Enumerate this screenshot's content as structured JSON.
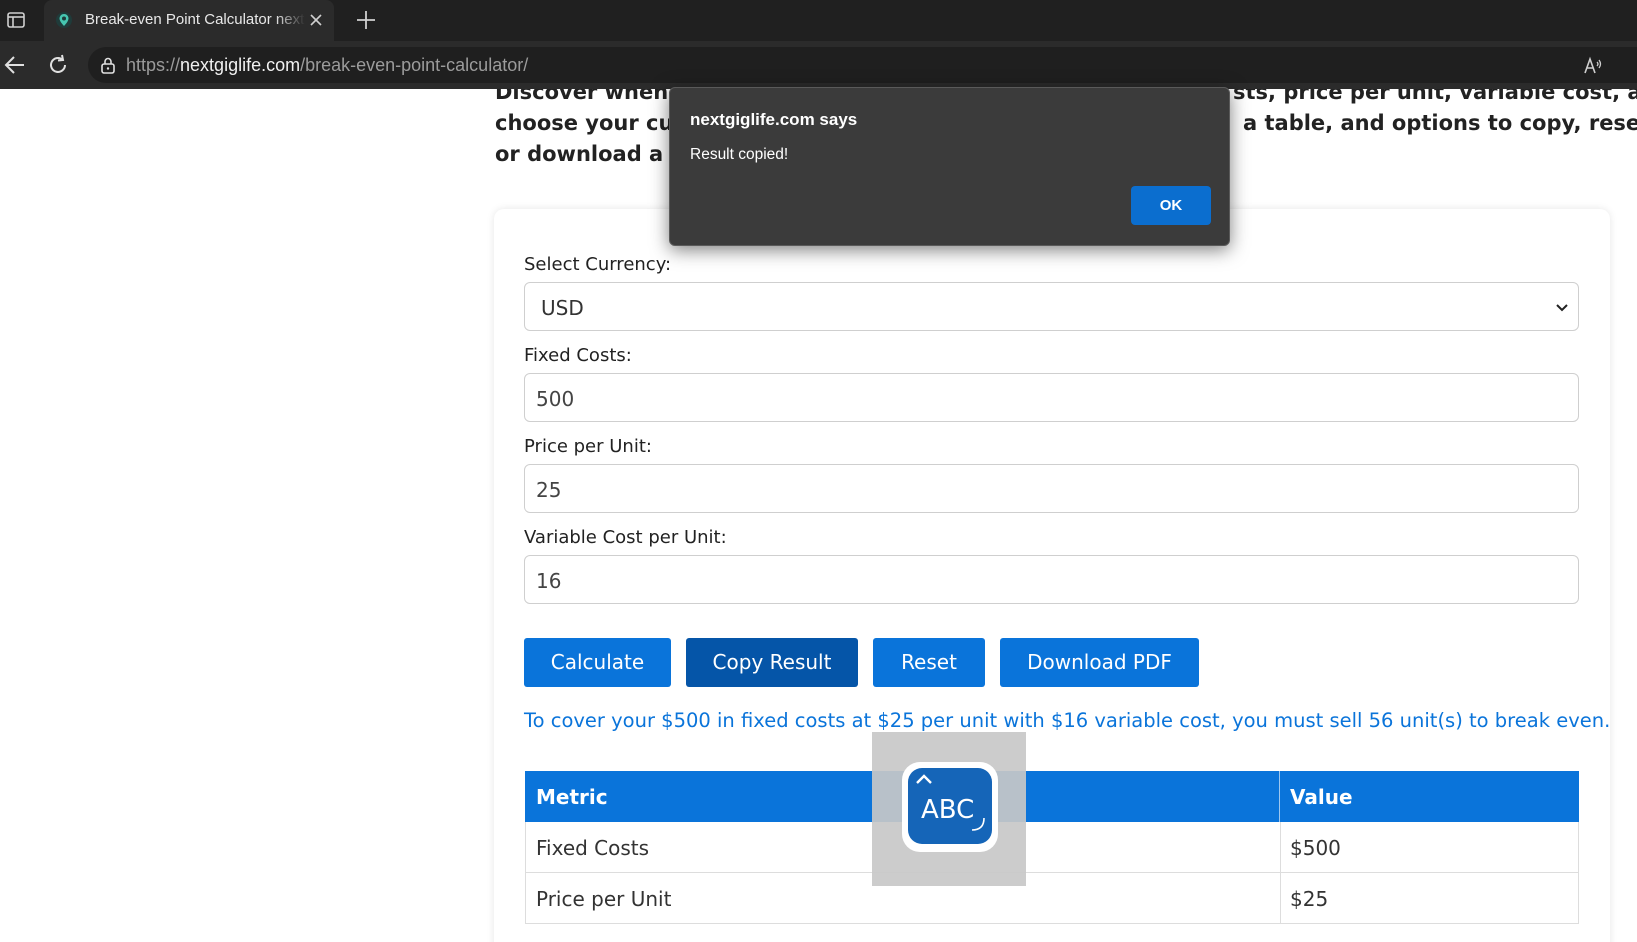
{
  "browser": {
    "tab_title": "Break-even Point Calculator nextgiglife",
    "url_prefix": "https://",
    "url_host": "nextgiglife.com",
    "url_path": "/break-even-point-calculator/",
    "read_aloud_glyph": "Aₙ"
  },
  "page": {
    "intro_line1": "Discover when y",
    "intro_line1_end": "sts, price per unit, variable cost, and",
    "intro_line2": "choose your curr",
    "intro_line2_end": "a table, and options to copy, reset,",
    "intro_line3": "or download a PI"
  },
  "form": {
    "currency_label": "Select Currency:",
    "currency_value": "USD",
    "fixed_label": "Fixed Costs:",
    "fixed_value": "500",
    "price_label": "Price per Unit:",
    "price_value": "25",
    "variable_label": "Variable Cost per Unit:",
    "variable_value": "16"
  },
  "buttons": {
    "calculate": "Calculate",
    "copy": "Copy Result",
    "reset": "Reset",
    "download": "Download PDF"
  },
  "result": "To cover your $500 in fixed costs at $25 per unit with $16 variable cost, you must sell 56 unit(s) to break even.",
  "table": {
    "headers": [
      "Metric",
      "Value"
    ],
    "rows": [
      {
        "metric": "Fixed Costs",
        "value": "$500"
      },
      {
        "metric": "Price per Unit",
        "value": "$25"
      }
    ]
  },
  "dialog": {
    "title": "nextgiglife.com says",
    "message": "Result copied!",
    "ok": "OK"
  },
  "ime": {
    "label": "ABC"
  },
  "colors": {
    "accent": "#0a74da",
    "accent_active": "#0555a8",
    "chrome_dark": "#202020",
    "dialog_bg": "#3b3b3b"
  }
}
